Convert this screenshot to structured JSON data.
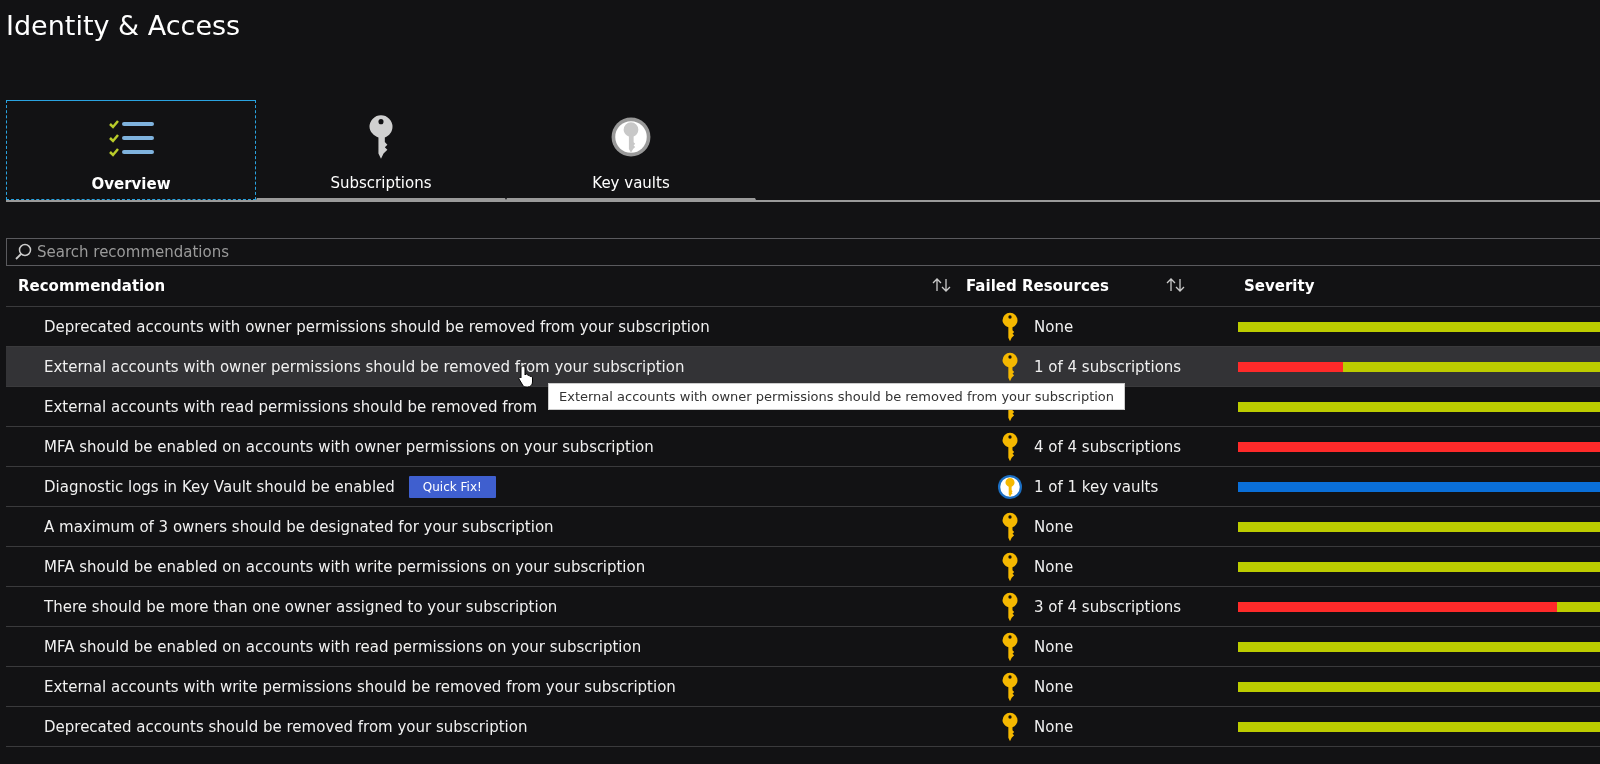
{
  "page": {
    "title": "Identity & Access"
  },
  "tabs": [
    {
      "label": "Overview",
      "kind": "checklist",
      "selected": true
    },
    {
      "label": "Subscriptions",
      "kind": "key",
      "selected": false
    },
    {
      "label": "Key vaults",
      "kind": "vault",
      "selected": false
    }
  ],
  "search": {
    "placeholder": "Search recommendations"
  },
  "table": {
    "columns": [
      {
        "label": "Recommendation",
        "sortable": true
      },
      {
        "label": "Failed Resources",
        "sortable": true
      },
      {
        "label": "Severity",
        "sortable": false
      }
    ],
    "rows": [
      {
        "recommendation": "Deprecated accounts with owner permissions should be removed from your subscription",
        "kind": "key",
        "failed": "None",
        "hovered": false,
        "severity": [
          {
            "color": "#bccc00",
            "level": 1
          }
        ]
      },
      {
        "recommendation": "External accounts with owner permissions should be removed from your subscription",
        "kind": "key",
        "failed": "1 of 4 subscriptions",
        "hovered": true,
        "severity": [
          {
            "color": "#ff2a2a",
            "level": 0.29
          },
          {
            "color": "#bccc00",
            "level": 0.71
          }
        ]
      },
      {
        "recommendation": "External accounts with read permissions should be removed from",
        "kind": "key",
        "hovered": false,
        "severity": [
          {
            "color": "#bccc00",
            "level": 1
          }
        ]
      },
      {
        "recommendation": "MFA should be enabled on accounts with owner permissions on your subscription",
        "kind": "key",
        "failed": "4 of 4 subscriptions",
        "hovered": false,
        "severity": [
          {
            "color": "#ff2a2a",
            "level": 1
          }
        ]
      },
      {
        "recommendation": "Diagnostic logs in Key Vault should be enabled",
        "action": "Quick Fix!",
        "kind": "vault",
        "failed": "1 of 1 key vaults",
        "hovered": false,
        "severity": [
          {
            "color": "#0a6fd8",
            "level": 1
          }
        ]
      },
      {
        "recommendation": "A maximum of 3 owners should be designated for your subscription",
        "kind": "key",
        "failed": "None",
        "hovered": false,
        "severity": [
          {
            "color": "#bccc00",
            "level": 1
          }
        ]
      },
      {
        "recommendation": "MFA should be enabled on accounts with write permissions on your subscription",
        "kind": "key",
        "failed": "None",
        "hovered": false,
        "severity": [
          {
            "color": "#bccc00",
            "level": 1
          }
        ]
      },
      {
        "recommendation": "There should be more than one owner assigned to your subscription",
        "kind": "key",
        "failed": "3 of 4 subscriptions",
        "hovered": false,
        "severity": [
          {
            "color": "#ff2a2a",
            "level": 0.88
          },
          {
            "color": "#bccc00",
            "level": 0.12
          }
        ]
      },
      {
        "recommendation": "MFA should be enabled on accounts with read permissions on your subscription",
        "kind": "key",
        "failed": "None",
        "hovered": false,
        "severity": [
          {
            "color": "#bccc00",
            "level": 1
          }
        ]
      },
      {
        "recommendation": "External accounts with write permissions should be removed from your subscription",
        "kind": "key",
        "failed": "None",
        "hovered": false,
        "severity": [
          {
            "color": "#bccc00",
            "level": 1
          }
        ]
      },
      {
        "recommendation": "Deprecated accounts should be removed from your subscription",
        "kind": "key",
        "failed": "None",
        "hovered": false,
        "severity": [
          {
            "color": "#bccc00",
            "level": 1
          }
        ]
      }
    ]
  },
  "tooltip": {
    "text": "External accounts with owner permissions should be removed from your subscription"
  }
}
